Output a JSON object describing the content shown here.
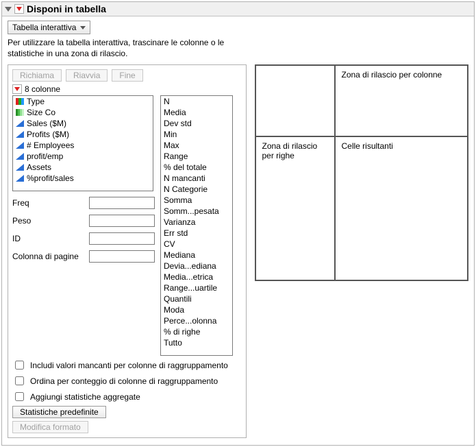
{
  "header": {
    "title": "Disponi in tabella"
  },
  "toolbar": {
    "mode_label": "Tabella interattiva",
    "hint": "Per utilizzare la tabella interattiva, trascinare le colonne o le statistiche in una zona di rilascio."
  },
  "buttons": {
    "recall": "Richiama",
    "restart": "Riavvia",
    "done": "Fine"
  },
  "columns": {
    "count_label": "8 colonne",
    "items": [
      {
        "name": "Type",
        "icon": "nom"
      },
      {
        "name": "Size Co",
        "icon": "ord"
      },
      {
        "name": "Sales ($M)",
        "icon": "cont"
      },
      {
        "name": "Profits ($M)",
        "icon": "cont"
      },
      {
        "name": "# Employees",
        "icon": "cont"
      },
      {
        "name": "profit/emp",
        "icon": "cont"
      },
      {
        "name": "Assets",
        "icon": "cont"
      },
      {
        "name": "%profit/sales",
        "icon": "cont"
      }
    ]
  },
  "fields": {
    "freq": "Freq",
    "weight": "Peso",
    "id": "ID",
    "page_col": "Colonna di pagine"
  },
  "stats": [
    "N",
    "Media",
    "Dev std",
    "Min",
    "Max",
    "Range",
    "% del totale",
    "N mancanti",
    "N Categorie",
    "Somma",
    "Somm...pesata",
    "Varianza",
    "Err std",
    "CV",
    "Mediana",
    "Devia...ediana",
    "Media...etrica",
    "Range...uartile",
    "Quantili",
    "Moda",
    "Perce...olonna",
    "% di righe",
    "Tutto"
  ],
  "checks": {
    "include_missing": "Includi valori mancanti per colonne di raggruppamento",
    "order_by_count": "Ordina per conteggio di colonne di raggruppamento",
    "add_agg": "Aggiungi statistiche aggregate"
  },
  "footer": {
    "default_stats": "Statistiche predefinite",
    "edit_format": "Modifica formato"
  },
  "dropzones": {
    "cols": "Zona di rilascio per colonne",
    "rows": "Zona di rilascio per righe",
    "cells": "Celle risultanti"
  }
}
